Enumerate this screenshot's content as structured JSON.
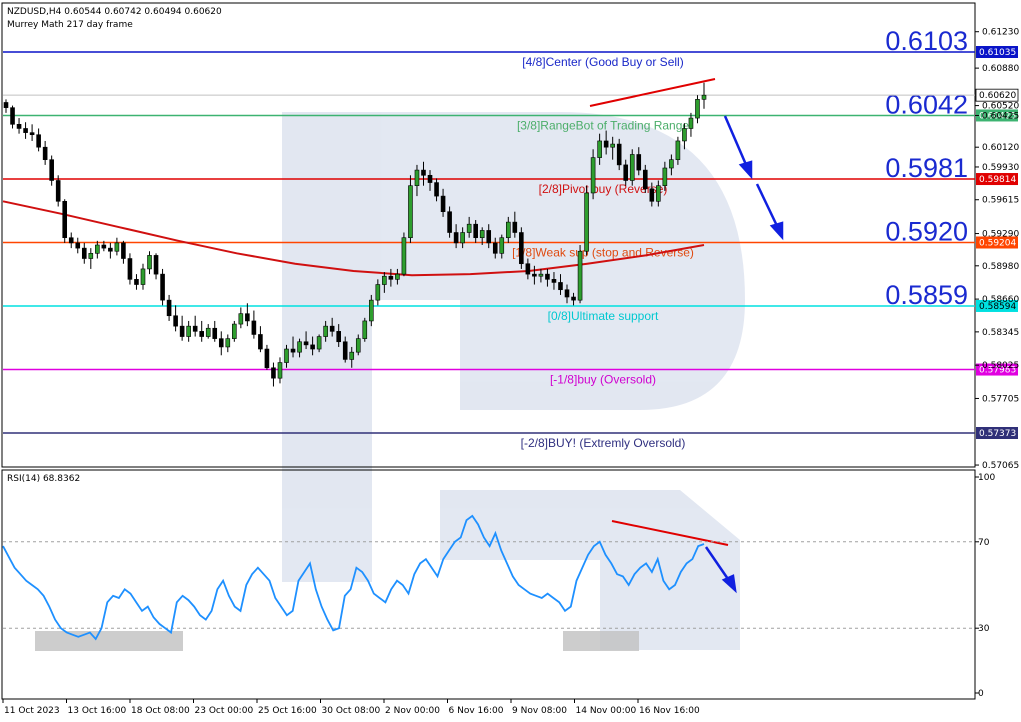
{
  "header": {
    "symbol_line": "NZDUSD,H4  0.60544 0.60742 0.60494 0.60620",
    "indicator_name": "Murrey Math 217 day frame"
  },
  "rsi_header": "RSI(14) 68.8362",
  "price_axis_ticks": [
    "0.61230",
    "0.60880",
    "0.60520",
    "0.60425",
    "0.60120",
    "0.59930",
    "0.59615",
    "0.59290",
    "0.58980",
    "0.58660",
    "0.58345",
    "0.58025",
    "0.57705",
    "0.57065"
  ],
  "rsi_axis_ticks": [
    "100",
    "70",
    "30",
    "0"
  ],
  "time_labels": [
    "11 Oct 2023",
    "13 Oct 16:00",
    "18 Oct 08:00",
    "23 Oct 00:00",
    "25 Oct 16:00",
    "30 Oct 08:00",
    "2 Nov 00:00",
    "6 Nov 16:00",
    "9 Nov 08:00",
    "14 Nov 00:00",
    "16 Nov 16:00"
  ],
  "current_price_tag": "0.60620",
  "levels": [
    {
      "price": 0.61035,
      "tag": "0.61035",
      "big": "0.6103",
      "label": "[4/8]Center (Good Buy or Sell)",
      "color": "#0a14c8",
      "label_color": "#1a28c8"
    },
    {
      "price": 0.60425,
      "tag": "0.60425",
      "big": "0.6042",
      "label": "[3/8]RangeBot of Trading Range",
      "color": "#3cb371",
      "label_color": "#4cae6a"
    },
    {
      "price": 0.59814,
      "tag": "0.59814",
      "big": "0.5981",
      "label": "[2/8]Pivot buy (Reverse)",
      "color": "#e00000",
      "label_color": "#d01010"
    },
    {
      "price": 0.59204,
      "tag": "0.59204",
      "big": "0.5920",
      "label": "[1/8]Weak sup (stop and Reverse)",
      "color": "#ff4500",
      "label_color": "#e04a10"
    },
    {
      "price": 0.58594,
      "tag": "0.58594",
      "big": "0.5859",
      "label": "[0/8]Ultimate support",
      "color": "#00e0e0",
      "label_color": "#00c8d0"
    },
    {
      "price": 0.57983,
      "tag": "0.57983",
      "big": "",
      "label": "[-1/8]buy (Oversold)",
      "color": "#e000e0",
      "label_color": "#d000d0"
    },
    {
      "price": 0.57373,
      "tag": "0.57373",
      "big": "",
      "label": "[-2/8]BUY! (Extremly Oversold)",
      "color": "#303078",
      "label_color": "#303080"
    }
  ],
  "chart_data": [
    {
      "type": "candlestick",
      "title": "NZDUSD,H4",
      "ylim": [
        0.57,
        0.6135
      ],
      "ohlc": [
        [
          0.6055,
          0.6058,
          0.6045,
          0.605
        ],
        [
          0.605,
          0.6052,
          0.603,
          0.6034
        ],
        [
          0.6034,
          0.604,
          0.6025,
          0.603
        ],
        [
          0.603,
          0.6036,
          0.602,
          0.6026
        ],
        [
          0.6026,
          0.6034,
          0.6018,
          0.6024
        ],
        [
          0.6024,
          0.603,
          0.6008,
          0.6012
        ],
        [
          0.6012,
          0.6018,
          0.5995,
          0.6
        ],
        [
          0.6,
          0.6004,
          0.5975,
          0.598
        ],
        [
          0.598,
          0.5985,
          0.5955,
          0.596
        ],
        [
          0.596,
          0.5962,
          0.592,
          0.5925
        ],
        [
          0.5925,
          0.593,
          0.5915,
          0.592
        ],
        [
          0.592,
          0.5925,
          0.591,
          0.5915
        ],
        [
          0.5915,
          0.592,
          0.59,
          0.5905
        ],
        [
          0.5905,
          0.5915,
          0.5895,
          0.591
        ],
        [
          0.591,
          0.5922,
          0.5905,
          0.5918
        ],
        [
          0.5918,
          0.5922,
          0.5912,
          0.5915
        ],
        [
          0.5915,
          0.592,
          0.5905,
          0.5912
        ],
        [
          0.5912,
          0.5925,
          0.5908,
          0.592
        ],
        [
          0.592,
          0.5922,
          0.59,
          0.5905
        ],
        [
          0.5905,
          0.591,
          0.588,
          0.5885
        ],
        [
          0.5885,
          0.589,
          0.5875,
          0.588
        ],
        [
          0.588,
          0.59,
          0.5875,
          0.5895
        ],
        [
          0.5895,
          0.5912,
          0.589,
          0.5908
        ],
        [
          0.5908,
          0.591,
          0.5885,
          0.589
        ],
        [
          0.589,
          0.5895,
          0.586,
          0.5865
        ],
        [
          0.5865,
          0.587,
          0.5845,
          0.585
        ],
        [
          0.585,
          0.586,
          0.5835,
          0.584
        ],
        [
          0.584,
          0.585,
          0.5826,
          0.583
        ],
        [
          0.583,
          0.5845,
          0.5825,
          0.584
        ],
        [
          0.584,
          0.585,
          0.583,
          0.5835
        ],
        [
          0.5835,
          0.5845,
          0.5825,
          0.583
        ],
        [
          0.583,
          0.5842,
          0.5828,
          0.5838
        ],
        [
          0.5838,
          0.5845,
          0.5825,
          0.5828
        ],
        [
          0.5828,
          0.5835,
          0.5812,
          0.582
        ],
        [
          0.582,
          0.5832,
          0.5815,
          0.5828
        ],
        [
          0.5828,
          0.5845,
          0.5825,
          0.5842
        ],
        [
          0.5842,
          0.5858,
          0.5838,
          0.5852
        ],
        [
          0.5852,
          0.5862,
          0.584,
          0.5845
        ],
        [
          0.5845,
          0.5855,
          0.5828,
          0.5832
        ],
        [
          0.5832,
          0.584,
          0.5815,
          0.5818
        ],
        [
          0.5818,
          0.5822,
          0.5798,
          0.58
        ],
        [
          0.58,
          0.5805,
          0.5782,
          0.579
        ],
        [
          0.579,
          0.581,
          0.5785,
          0.5805
        ],
        [
          0.5805,
          0.5822,
          0.58,
          0.5818
        ],
        [
          0.5818,
          0.583,
          0.581,
          0.5815
        ],
        [
          0.5815,
          0.5828,
          0.581,
          0.5825
        ],
        [
          0.5825,
          0.5835,
          0.5818,
          0.5822
        ],
        [
          0.5822,
          0.583,
          0.5812,
          0.5818
        ],
        [
          0.5818,
          0.5832,
          0.5815,
          0.583
        ],
        [
          0.583,
          0.5845,
          0.5825,
          0.584
        ],
        [
          0.584,
          0.5848,
          0.583,
          0.5835
        ],
        [
          0.5835,
          0.5842,
          0.582,
          0.5825
        ],
        [
          0.5825,
          0.583,
          0.5805,
          0.5808
        ],
        [
          0.5808,
          0.582,
          0.58,
          0.5815
        ],
        [
          0.5815,
          0.5832,
          0.5812,
          0.5828
        ],
        [
          0.5828,
          0.5848,
          0.5825,
          0.5845
        ],
        [
          0.5845,
          0.587,
          0.584,
          0.5865
        ],
        [
          0.5865,
          0.5885,
          0.586,
          0.588
        ],
        [
          0.588,
          0.5892,
          0.5872,
          0.5888
        ],
        [
          0.5888,
          0.5895,
          0.5878,
          0.5885
        ],
        [
          0.5885,
          0.5895,
          0.588,
          0.589
        ],
        [
          0.589,
          0.593,
          0.5888,
          0.5925
        ],
        [
          0.5925,
          0.5985,
          0.592,
          0.5975
        ],
        [
          0.5975,
          0.5995,
          0.5965,
          0.599
        ],
        [
          0.599,
          0.5998,
          0.5975,
          0.5985
        ],
        [
          0.5985,
          0.599,
          0.597,
          0.5978
        ],
        [
          0.5978,
          0.5982,
          0.596,
          0.5965
        ],
        [
          0.5965,
          0.5972,
          0.5945,
          0.595
        ],
        [
          0.595,
          0.5955,
          0.5925,
          0.593
        ],
        [
          0.593,
          0.5938,
          0.5915,
          0.592
        ],
        [
          0.592,
          0.5935,
          0.5915,
          0.593
        ],
        [
          0.593,
          0.5945,
          0.5925,
          0.5938
        ],
        [
          0.5938,
          0.5942,
          0.592,
          0.5925
        ],
        [
          0.5925,
          0.5935,
          0.5918,
          0.5932
        ],
        [
          0.5932,
          0.5938,
          0.5915,
          0.592
        ],
        [
          0.592,
          0.5925,
          0.5905,
          0.591
        ],
        [
          0.591,
          0.5928,
          0.5905,
          0.5925
        ],
        [
          0.5925,
          0.5945,
          0.592,
          0.594
        ],
        [
          0.594,
          0.595,
          0.5925,
          0.593
        ],
        [
          0.593,
          0.5935,
          0.5895,
          0.59
        ],
        [
          0.59,
          0.5905,
          0.5885,
          0.589
        ],
        [
          0.589,
          0.5898,
          0.588,
          0.5888
        ],
        [
          0.5888,
          0.5895,
          0.5882,
          0.589
        ],
        [
          0.589,
          0.5895,
          0.5878,
          0.5885
        ],
        [
          0.5885,
          0.5892,
          0.5875,
          0.5882
        ],
        [
          0.5882,
          0.589,
          0.587,
          0.5875
        ],
        [
          0.5875,
          0.588,
          0.5862,
          0.5868
        ],
        [
          0.5868,
          0.5872,
          0.586,
          0.5865
        ],
        [
          0.5865,
          0.5918,
          0.5862,
          0.5912
        ],
        [
          0.5912,
          0.5975,
          0.5908,
          0.5968
        ],
        [
          0.5968,
          0.601,
          0.5962,
          0.6002
        ],
        [
          0.6002,
          0.6025,
          0.5995,
          0.6018
        ],
        [
          0.6018,
          0.6028,
          0.6005,
          0.6012
        ],
        [
          0.6012,
          0.6022,
          0.6,
          0.6015
        ],
        [
          0.6015,
          0.602,
          0.599,
          0.5995
        ],
        [
          0.5995,
          0.6,
          0.5975,
          0.598
        ],
        [
          0.598,
          0.601,
          0.5975,
          0.6005
        ],
        [
          0.6005,
          0.6012,
          0.5985,
          0.599
        ],
        [
          0.599,
          0.5995,
          0.5968,
          0.5972
        ],
        [
          0.5972,
          0.5978,
          0.5955,
          0.596
        ],
        [
          0.596,
          0.598,
          0.5955,
          0.5975
        ],
        [
          0.5975,
          0.5998,
          0.597,
          0.5992
        ],
        [
          0.5992,
          0.6005,
          0.5985,
          0.6
        ],
        [
          0.6,
          0.6022,
          0.5995,
          0.6018
        ],
        [
          0.6018,
          0.6035,
          0.601,
          0.603
        ],
        [
          0.603,
          0.6045,
          0.6022,
          0.604
        ],
        [
          0.604,
          0.6062,
          0.6035,
          0.6058
        ],
        [
          0.6058,
          0.6074,
          0.6049,
          0.6062
        ]
      ],
      "ma_217": [
        0.596,
        0.5948,
        0.5935,
        0.5922,
        0.591,
        0.59,
        0.5893,
        0.5889,
        0.589,
        0.5893,
        0.59,
        0.5908,
        0.5918
      ],
      "trendlines": [
        "resistance rising",
        "current trend up"
      ]
    },
    {
      "type": "line",
      "title": "RSI(14) 68.8362",
      "ylim": [
        0,
        100
      ],
      "levels": [
        70,
        30
      ],
      "values": [
        68,
        63,
        58,
        55,
        52,
        50,
        48,
        45,
        40,
        34,
        30,
        28,
        27,
        26,
        27,
        28,
        25,
        30,
        42,
        45,
        44,
        48,
        46,
        42,
        38,
        40,
        35,
        32,
        30,
        28,
        42,
        45,
        43,
        40,
        36,
        34,
        38,
        48,
        52,
        45,
        40,
        38,
        50,
        55,
        58,
        55,
        52,
        44,
        40,
        36,
        38,
        52,
        56,
        60,
        48,
        40,
        34,
        29,
        30,
        45,
        48,
        58,
        56,
        52,
        46,
        44,
        42,
        48,
        52,
        50,
        46,
        55,
        60,
        62,
        58,
        54,
        62,
        66,
        70,
        72,
        80,
        82,
        78,
        72,
        68,
        74,
        66,
        60,
        54,
        50,
        48,
        46,
        45,
        44,
        46,
        44,
        42,
        38,
        40,
        52,
        58,
        64,
        68,
        70,
        64,
        60,
        55,
        54,
        50,
        55,
        58,
        60,
        56,
        62,
        52,
        48,
        50,
        56,
        60,
        62,
        68,
        69
      ]
    }
  ]
}
